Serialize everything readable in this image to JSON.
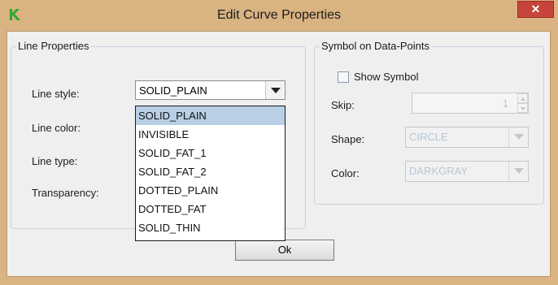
{
  "window": {
    "title": "Edit Curve Properties",
    "close_glyph": "✕",
    "app_icon": "green-arrow-icon"
  },
  "line_properties": {
    "group_title": "Line Properties",
    "line_style_label": "Line style:",
    "line_style_value": "SOLID_PLAIN",
    "line_color_label": "Line color:",
    "line_type_label": "Line type:",
    "transparency_label": "Transparency:",
    "dropdown_options": [
      "SOLID_PLAIN",
      "INVISIBLE",
      "SOLID_FAT_1",
      "SOLID_FAT_2",
      "DOTTED_PLAIN",
      "DOTTED_FAT",
      "SOLID_THIN"
    ],
    "selected_option": "SOLID_PLAIN"
  },
  "symbol": {
    "group_title": "Symbol on Data-Points",
    "show_symbol_label": "Show Symbol",
    "show_symbol_checked": false,
    "skip_label": "Skip:",
    "skip_value": "1",
    "shape_label": "Shape:",
    "shape_value": "CIRCLE",
    "color_label": "Color:",
    "color_value": "DARKGRAY"
  },
  "buttons": {
    "ok_label": "Ok"
  },
  "colors": {
    "titlebar": "#d9b381",
    "close": "#c7443b",
    "selection": "#b8cfe5",
    "disabled_text": "#b8c6d4"
  }
}
